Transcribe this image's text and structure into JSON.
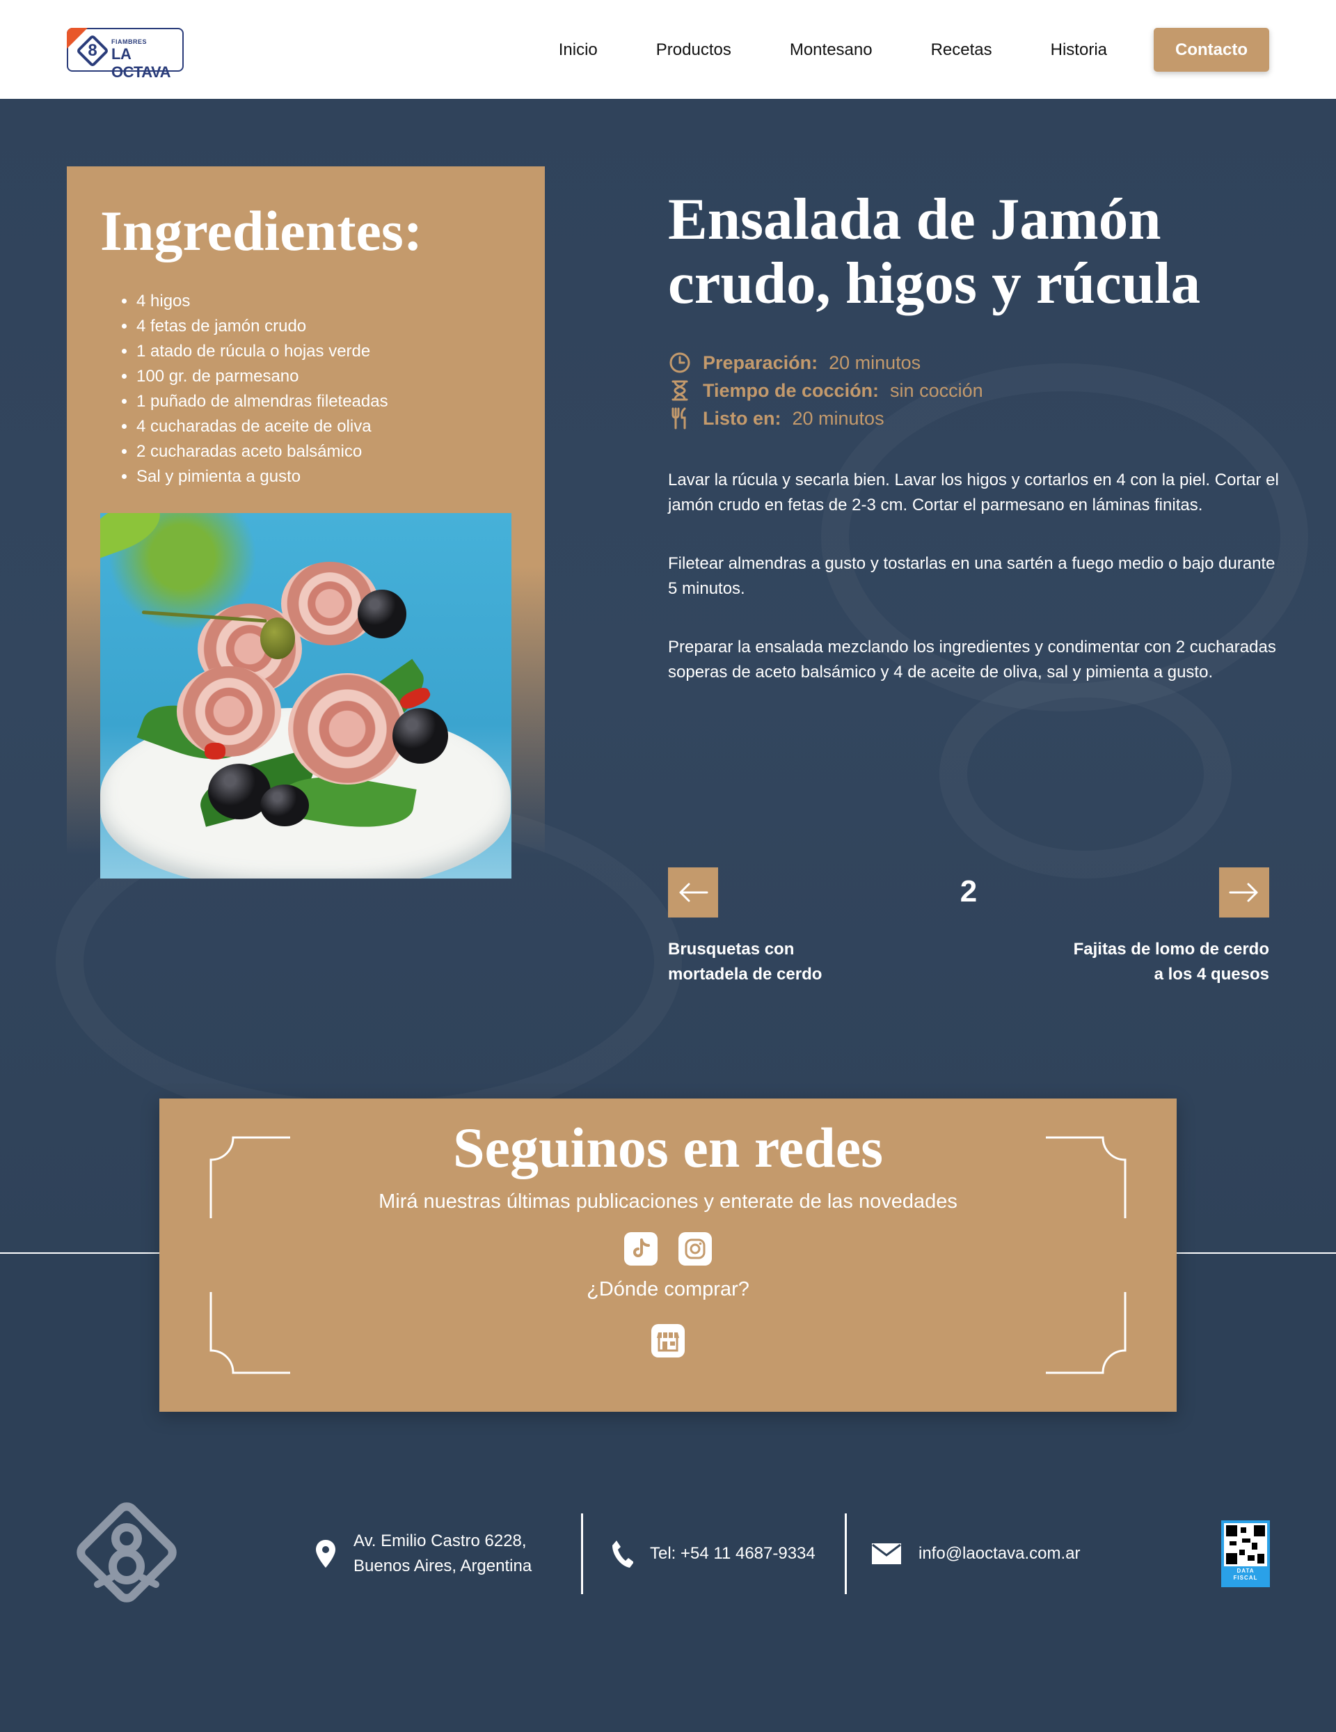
{
  "header": {
    "logo_small": "FIAMBRES",
    "logo_big": "LA OCTAVA",
    "nav": [
      "Inicio",
      "Productos",
      "Montesano",
      "Recetas",
      "Historia"
    ],
    "cta": "Contacto"
  },
  "ingredients": {
    "title": "Ingredientes:",
    "items": [
      "4 higos",
      "4 fetas de jamón crudo",
      "1 atado de rúcula o hojas verde",
      "100 gr. de parmesano",
      "1 puñado de almendras fileteadas",
      "4 cucharadas de aceite de oliva",
      "2 cucharadas aceto balsámico",
      "Sal y pimienta a gusto"
    ]
  },
  "recipe": {
    "title": "Ensalada de Jamón crudo, higos y rúcula",
    "meta": [
      {
        "icon": "clock-icon",
        "label": "Preparación:",
        "value": "20 minutos"
      },
      {
        "icon": "hourglass-icon",
        "label": "Tiempo de cocción:",
        "value": "sin cocción"
      },
      {
        "icon": "utensils-icon",
        "label": "Listo en:",
        "value": "20 minutos"
      }
    ],
    "steps": [
      "Lavar la rúcula y secarla bien. Lavar los higos y cortarlos en 4 con la piel. Cortar el jamón crudo en fetas de 2-3 cm. Cortar el parmesano en láminas finitas.",
      "Filetear almendras a gusto y tostarlas en una sartén a fuego medio o bajo durante 5 minutos.",
      "Preparar la ensalada mezclando los ingredientes y condimentar con 2 cucharadas soperas de aceto balsámico y 4 de aceite de oliva, sal y pimienta a gusto."
    ]
  },
  "pager": {
    "current": "2",
    "prev_label": "Brusquetas con mortadela de cerdo",
    "next_label": "Fajitas de lomo de cerdo a los 4 quesos"
  },
  "social": {
    "title": "Seguinos en redes",
    "subtitle": "Mirá nuestras últimas publicaciones y enterate de las novedades",
    "where": "¿Dónde comprar?"
  },
  "footer": {
    "address_line1": "Av. Emilio Castro 6228,",
    "address_line2": "Buenos Aires, Argentina",
    "phone": "Tel: +54 11 4687-9334",
    "email": "info@laoctava.com.ar",
    "qr_caption": "DATA FISCAL"
  },
  "colors": {
    "accent": "#c49a6c",
    "background": "#2d4057",
    "logo_blue": "#2a3c7a",
    "logo_orange": "#e8572a"
  }
}
